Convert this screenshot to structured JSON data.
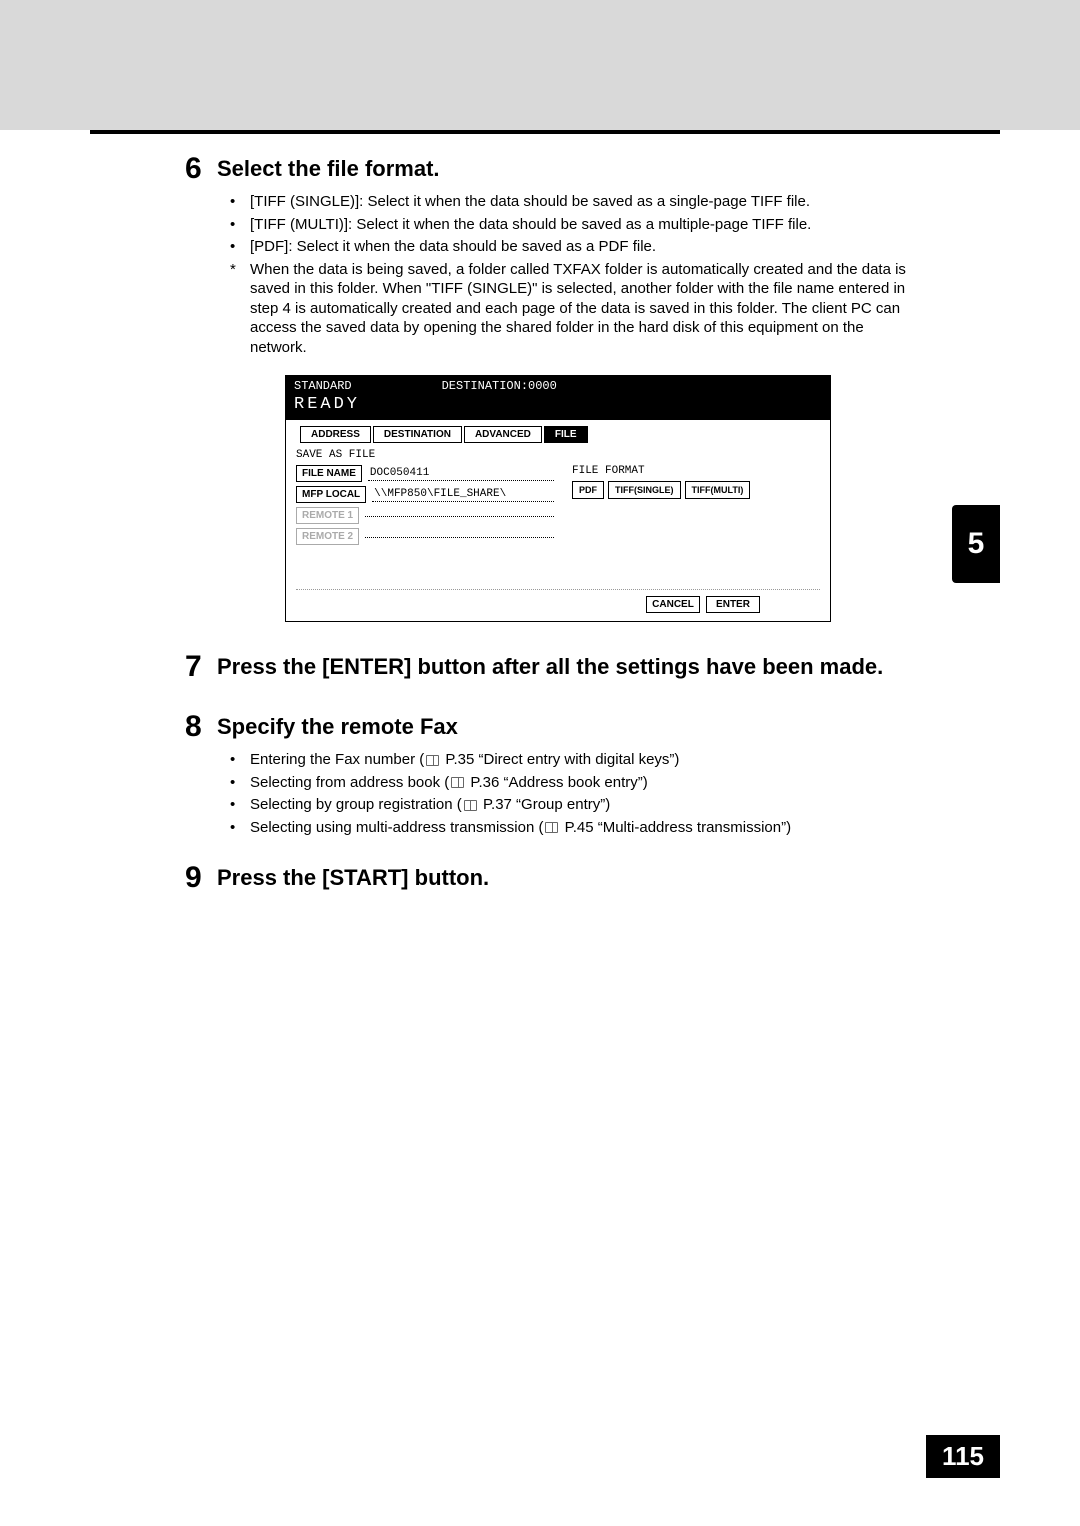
{
  "steps": {
    "s6": {
      "num": "6",
      "title": "Select the file format.",
      "b1": "[TIFF (SINGLE)]: Select it when the data should be saved as a single-page TIFF file.",
      "b2": "[TIFF (MULTI)]: Select it when the data should be saved as a multiple-page TIFF file.",
      "b3": "[PDF]: Select it when the data should be saved as a PDF file.",
      "note": "When the data is being saved, a folder called TXFAX folder is automatically created and the data is saved in this folder. When \"TIFF (SINGLE)\" is selected, another folder with the file name entered in step 4 is automatically created and each page of the data is saved in this folder. The client PC can access the saved data by opening the shared folder in the hard disk of this equipment on the network."
    },
    "s7": {
      "num": "7",
      "title": "Press the [ENTER] button after all the settings have been made."
    },
    "s8": {
      "num": "8",
      "title": "Specify the remote Fax",
      "b1a": "Entering the Fax number (",
      "b1b": " P.35 “Direct entry with digital keys”)",
      "b2a": "Selecting from address book (",
      "b2b": " P.36 “Address book entry”)",
      "b3a": "Selecting by group registration (",
      "b3b": " P.37 “Group entry”)",
      "b4a": "Selecting using multi-address transmission (",
      "b4b": " P.45 “Multi-address transmission”)"
    },
    "s9": {
      "num": "9",
      "title": "Press the [START] button."
    }
  },
  "scr": {
    "standard": "STANDARD",
    "dest": "DESTINATION:0000",
    "ready": "READY",
    "tab_address": "ADDRESS",
    "tab_destination": "DESTINATION",
    "tab_advanced": "ADVANCED",
    "tab_file": "FILE",
    "save_as_file": "SAVE AS FILE",
    "file_name_btn": "FILE NAME",
    "file_name_val": "DOC050411",
    "mfp_local_btn": "MFP LOCAL",
    "mfp_local_val": "\\\\MFP850\\FILE_SHARE\\",
    "remote1_btn": "REMOTE 1",
    "remote2_btn": "REMOTE 2",
    "file_format": "FILE FORMAT",
    "fmt_pdf": "PDF",
    "fmt_tiff_single": "TIFF(SINGLE)",
    "fmt_tiff_multi": "TIFF(MULTI)",
    "cancel": "CANCEL",
    "enter": "ENTER"
  },
  "side_tab": "5",
  "page_number": "115"
}
